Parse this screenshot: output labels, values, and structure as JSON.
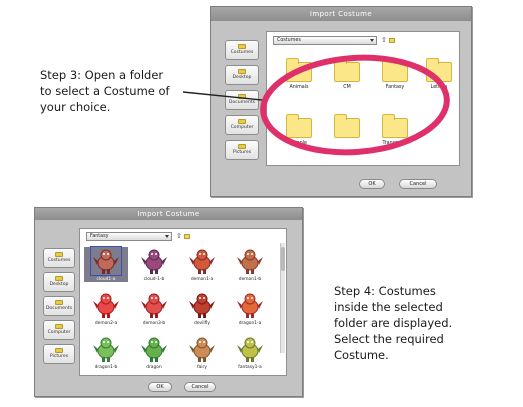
{
  "step3": {
    "lines": [
      "Step 3: Open a folder",
      "to select a Costume of",
      "your choice."
    ]
  },
  "step4": {
    "lines": [
      "Step 4: Costumes",
      "inside the selected",
      "folder are displayed.",
      "Select the required",
      "Costume."
    ]
  },
  "dialog1": {
    "title": "Import Costume",
    "sidebar": [
      "Costumes",
      "Desktop",
      "Documents",
      "Computer",
      "Pictures"
    ],
    "path": "Costumes",
    "folders": [
      "Animals",
      "CM",
      "Fantasy",
      "Letters",
      "People",
      "",
      "Transports"
    ],
    "ok_label": "OK",
    "cancel_label": "Cancel",
    "highlight_color": "#e0306a"
  },
  "dialog2": {
    "title": "Import Costume",
    "sidebar": [
      "Costumes",
      "Desktop",
      "Documents",
      "Computer",
      "Pictures"
    ],
    "path": "Fantasy",
    "costumes": [
      {
        "name": "cloud1-a",
        "icon": "cloud-creature-icon",
        "selected": true
      },
      {
        "name": "cloud-1-b",
        "icon": "witch-creature-icon"
      },
      {
        "name": "demon1-a",
        "icon": "demon-icon"
      },
      {
        "name": "demon1-b",
        "icon": "small-demon-icon"
      },
      {
        "name": "demon2-a",
        "icon": "red-demon-icon"
      },
      {
        "name": "demon3-b",
        "icon": "red-demon2-icon"
      },
      {
        "name": "devilfly",
        "icon": "devil-fly-icon"
      },
      {
        "name": "dragon1-a",
        "icon": "dragon-icon"
      },
      {
        "name": "dragon1-b",
        "icon": "green-dragon-icon"
      },
      {
        "name": "dragon",
        "icon": "green-dragon2-icon"
      },
      {
        "name": "fairy",
        "icon": "fairy-icon"
      },
      {
        "name": "fantasy1-a",
        "icon": "fantasy-creature-icon"
      }
    ],
    "ok_label": "OK",
    "cancel_label": "Cancel"
  }
}
